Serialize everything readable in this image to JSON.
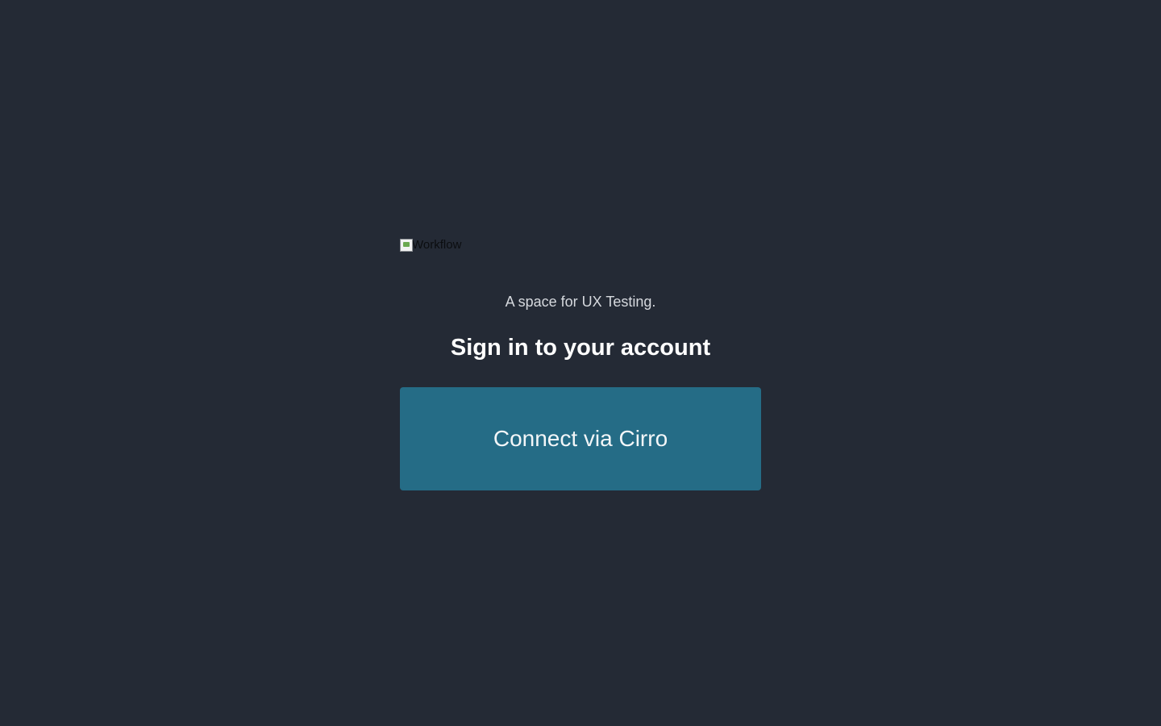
{
  "logo": {
    "alt_text": "Workflow",
    "icon": "broken-image-icon"
  },
  "tagline": "A space for UX Testing.",
  "heading": "Sign in to your account",
  "connect_button": {
    "label": "Connect via Cirro"
  },
  "colors": {
    "background": "#242a35",
    "button": "#256c86",
    "heading": "#ffffff",
    "tagline": "#d6d9de"
  }
}
